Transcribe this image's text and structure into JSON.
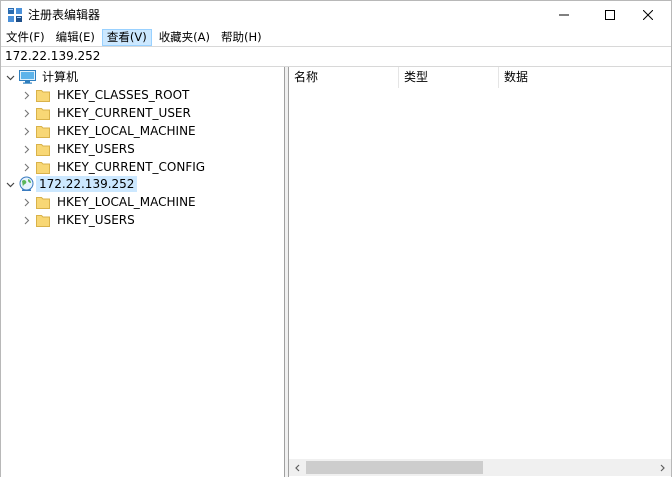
{
  "window": {
    "title": "注册表编辑器",
    "icon": "regedit-icon"
  },
  "menubar": {
    "items": [
      {
        "label": "文件(F)",
        "active": false
      },
      {
        "label": "编辑(E)",
        "active": false
      },
      {
        "label": "查看(V)",
        "active": true
      },
      {
        "label": "收藏夹(A)",
        "active": false
      },
      {
        "label": "帮助(H)",
        "active": false
      }
    ]
  },
  "addressbar": {
    "value": "172.22.139.252"
  },
  "tree": {
    "computer": {
      "label": "计算机",
      "expanded": true,
      "children": [
        {
          "label": "HKEY_CLASSES_ROOT"
        },
        {
          "label": "HKEY_CURRENT_USER"
        },
        {
          "label": "HKEY_LOCAL_MACHINE"
        },
        {
          "label": "HKEY_USERS"
        },
        {
          "label": "HKEY_CURRENT_CONFIG"
        }
      ]
    },
    "remote": {
      "label": "172.22.139.252",
      "expanded": true,
      "selected": true,
      "children": [
        {
          "label": "HKEY_LOCAL_MACHINE"
        },
        {
          "label": "HKEY_USERS"
        }
      ]
    }
  },
  "listview": {
    "columns": [
      {
        "label": "名称"
      },
      {
        "label": "类型"
      },
      {
        "label": "数据"
      }
    ],
    "rows": []
  },
  "colors": {
    "selection": "#cce8ff",
    "folder": "#f8d775",
    "scroll_thumb": "#cdcdcd"
  }
}
